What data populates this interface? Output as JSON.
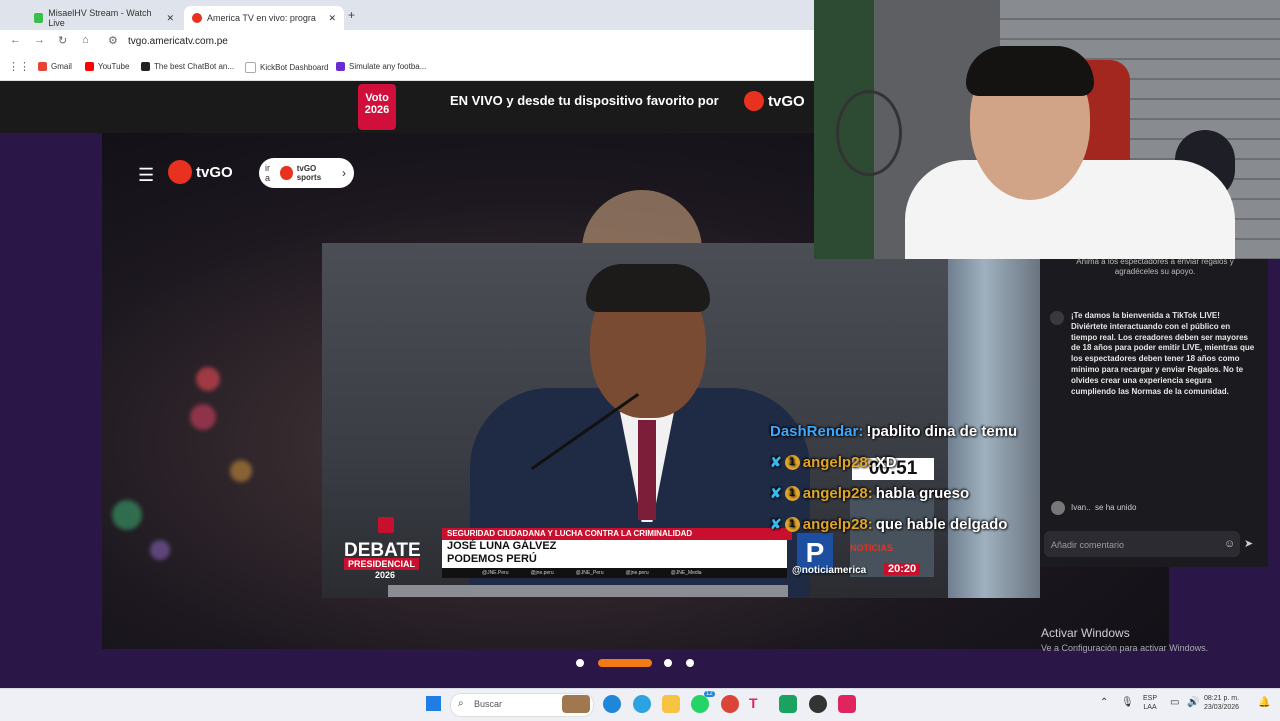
{
  "browser": {
    "tabs": [
      {
        "title": "MisaelHV Stream - Watch Live"
      },
      {
        "title": "America TV en vivo: progra"
      }
    ],
    "url": "tvgo.americatv.com.pe",
    "bookmarks": [
      "Gmail",
      "YouTube",
      "The best ChatBot an...",
      "KickBot Dashboard",
      "Simulate any footba..."
    ]
  },
  "banner": {
    "voto": "Voto",
    "voto_year": "2026",
    "text": "EN VIVO y desde tu dispositivo favorito por",
    "logo": "tvGO"
  },
  "site": {
    "logo": "tvGO",
    "sports_pill_prefix": "ir a",
    "sports_pill_brand": "tvGO sports"
  },
  "broadcast": {
    "debate_word": "DEBATE",
    "presidencial": "PRESIDENCIAL",
    "year": "2026",
    "topic": "SEGURIDAD CIUDADANA Y LUCHA CONTRA LA CRIMINALIDAD",
    "name": "JOSÉ LUNA GÁLVEZ",
    "party": "PODEMOS PERÚ",
    "socials": [
      "@JNE.Peru",
      "@jne.peru",
      "@JNE_Peru",
      "@jne.peru",
      "@JNE_Media"
    ],
    "noticias": "NOTICIAS",
    "clock": "20:20",
    "handle": "@noticiamerica",
    "timer": "00:51"
  },
  "chat_overlay": [
    {
      "user": "DashRendar:",
      "message": "!pablito dina de temu",
      "badges": false
    },
    {
      "user": "angelp28:",
      "message": "XD",
      "badges": true
    },
    {
      "user": "angelp28:",
      "message": "habla grueso",
      "badges": true
    },
    {
      "user": "angelp28:",
      "message": "que hable delgado",
      "badges": true
    }
  ],
  "tiktok": {
    "subtext": "Anima a los espectadores a enviar regalos y agradéceles su apoyo.",
    "welcome": "¡Te damos la bienvenida a TikTok LIVE! Diviértete interactuando con el público en tiempo real. Los creadores deben ser mayores de 18 años para poder emitir LIVE, mientras que los espectadores deben tener 18 años como mínimo para recargar y enviar Regalos. No te olvides crear una experiencia segura cumpliendo las Normas de la comunidad.",
    "join_user": "Ivan..",
    "join_text": "se ha unido",
    "input_placeholder": "Añadir comentario"
  },
  "windows": {
    "activate_title": "Activar Windows",
    "activate_sub": "Ve a Configuración para activar Windows.",
    "search_placeholder": "Buscar",
    "lang_top": "ESP",
    "lang_bottom": "LAA",
    "time": "08:21 p. m.",
    "date": "23/03/2026",
    "whatsapp_badge": "12"
  },
  "pager": {
    "active_index": 1,
    "count": 4
  }
}
